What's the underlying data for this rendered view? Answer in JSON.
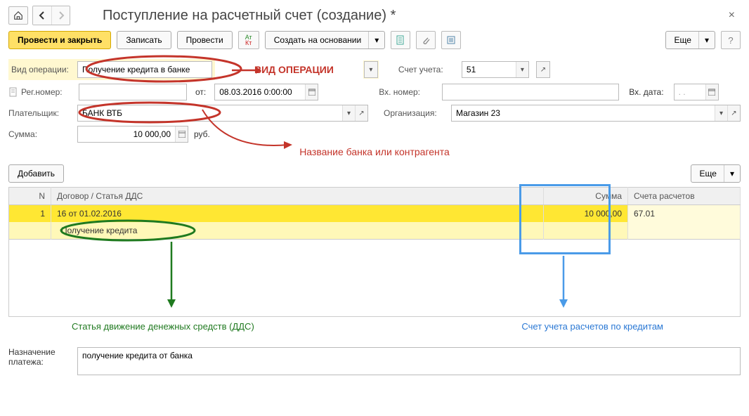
{
  "header": {
    "title": "Поступление на расчетный счет (создание) *"
  },
  "toolbar": {
    "post_close": "Провести и закрыть",
    "save": "Записать",
    "post": "Провести",
    "create_based": "Создать на основании",
    "more": "Еще"
  },
  "form": {
    "op_type_label": "Вид операции:",
    "op_type_value": "Получение кредита в банке",
    "reg_no_label": "Рег.номер:",
    "from_label": "от:",
    "date_value": "08.03.2016 0:00:00",
    "account_label": "Счет учета:",
    "account_value": "51",
    "in_no_label": "Вх. номер:",
    "in_date_label": "Вх. дата:",
    "in_date_value": ". .",
    "payer_label": "Плательщик:",
    "payer_value": "БАНК ВТБ",
    "org_label": "Организация:",
    "org_value": "Магазин 23",
    "sum_label": "Сумма:",
    "sum_value": "10 000,00",
    "currency": "руб."
  },
  "annotations": {
    "op_type": "ВИД ОПЕРАЦИИ",
    "bank_name": "Название банка или контрагента",
    "dds": "Статья движение денежных средств (ДДС)",
    "credit_acc": "Счет учета расчетов по кредитам"
  },
  "actions": {
    "add": "Добавить",
    "more": "Еще"
  },
  "table": {
    "headers": {
      "n": "N",
      "contract": "Договор / Статья ДДС",
      "sum": "Сумма",
      "acc": "Счета расчетов"
    },
    "rows": [
      {
        "n": "1",
        "contract": "16 от 01.02.2016",
        "sum": "10 000,00",
        "acc": "67.01"
      },
      {
        "contract": "Получение кредита"
      }
    ]
  },
  "bottom": {
    "purpose_label1": "Назначение",
    "purpose_label2": "платежа:",
    "purpose_value": "получение кредита от банка"
  }
}
